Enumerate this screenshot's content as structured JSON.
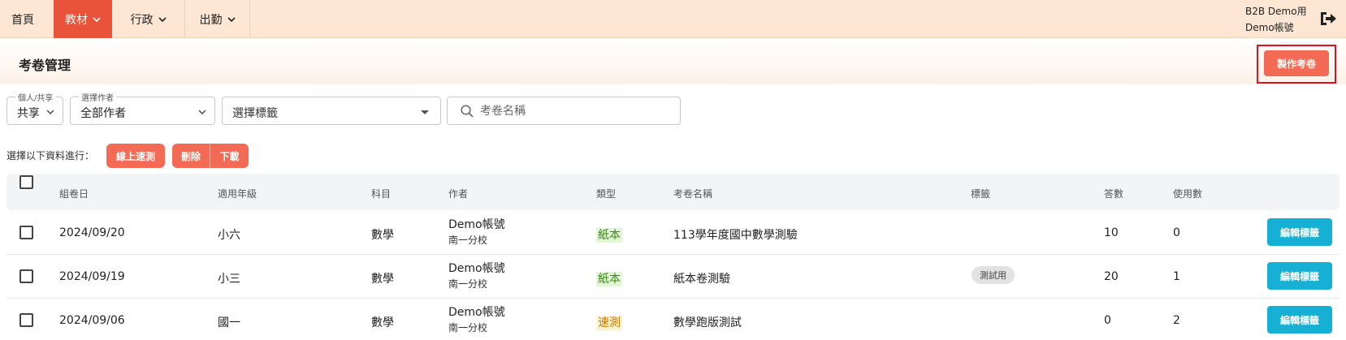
{
  "nav": {
    "items": [
      {
        "label": "首頁"
      },
      {
        "label": "教材"
      },
      {
        "label": "行政"
      },
      {
        "label": "出勤"
      }
    ],
    "user_line1": "B2B Demo用",
    "user_line2": "Demo帳號"
  },
  "page": {
    "title": "考卷管理",
    "make_button": "製作考卷"
  },
  "filters": {
    "scope": {
      "label": "個人/共享",
      "value": "共享"
    },
    "author": {
      "label": "選擇作者",
      "value": "全部作者"
    },
    "tags": {
      "value": "選擇標籤"
    },
    "search": {
      "placeholder": "考卷名稱"
    }
  },
  "actions": {
    "label": "選擇以下資料進行：",
    "online_test": "線上速測",
    "delete": "刪除",
    "download": "下載"
  },
  "table": {
    "headers": {
      "date": "組卷日",
      "grade": "適用年級",
      "subject": "科目",
      "author": "作者",
      "type": "類型",
      "name": "考卷名稱",
      "tag": "標籤",
      "answers": "答數",
      "usage": "使用數"
    },
    "rows": [
      {
        "date": "2024/09/20",
        "grade": "小六",
        "subject": "數學",
        "author": "Demo帳號",
        "branch": "南一分校",
        "type": "紙本",
        "name": "113學年度國中數學測驗",
        "tag": "",
        "answers": "10",
        "usage": "0",
        "edit": "編輯標籤"
      },
      {
        "date": "2024/09/19",
        "grade": "小三",
        "subject": "數學",
        "author": "Demo帳號",
        "branch": "南一分校",
        "type": "紙本",
        "name": "紙本卷測驗",
        "tag": "測試用",
        "answers": "20",
        "usage": "1",
        "edit": "編輯標籤"
      },
      {
        "date": "2024/09/06",
        "grade": "國一",
        "subject": "數學",
        "author": "Demo帳號",
        "branch": "南一分校",
        "type": "速測",
        "name": "數學跑版測試",
        "tag": "",
        "answers": "0",
        "usage": "2",
        "edit": "編輯標籤"
      }
    ]
  }
}
